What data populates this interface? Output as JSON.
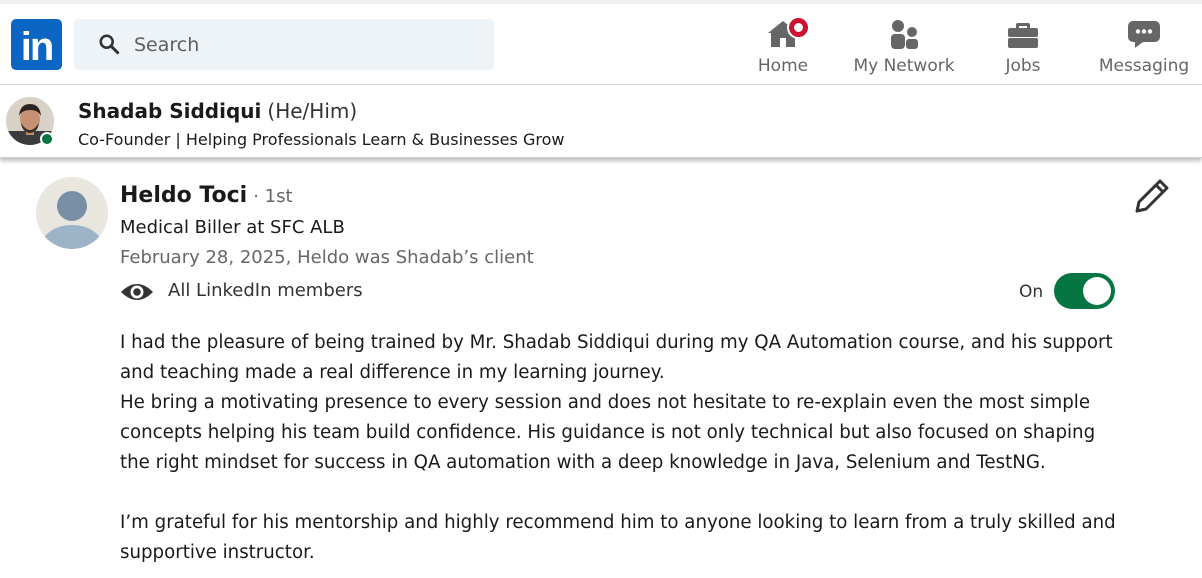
{
  "nav": {
    "logo_text": "in",
    "search_placeholder": "Search",
    "items": [
      {
        "label": "Home",
        "icon": "home-icon",
        "has_notification": true
      },
      {
        "label": "My Network",
        "icon": "people-icon"
      },
      {
        "label": "Jobs",
        "icon": "briefcase-icon"
      },
      {
        "label": "Messaging",
        "icon": "chat-icon"
      }
    ]
  },
  "profile": {
    "name": "Shadab Siddiqui",
    "pronouns": "(He/Him)",
    "headline": "Co-Founder | Helping Professionals Learn & Businesses Grow",
    "online": true
  },
  "recommendation": {
    "author_name": "Heldo Toci",
    "connection_degree": "· 1st",
    "author_title": "Medical Biller at SFC ALB",
    "meta": "February 28, 2025, Heldo was Shadab’s client",
    "visibility": "All LinkedIn members",
    "toggle_label": "On",
    "toggle_on": true,
    "paragraphs": [
      "I had the pleasure of being trained by Mr. Shadab Siddiqui during my QA Automation course, and his support and teaching made a real difference in my learning journey.",
      "He bring a motivating presence to every session and does not hesitate to re-explain even the most simple concepts helping his team build confidence. His guidance is not only technical but also focused on shaping the right mindset for success in QA automation with a deep knowledge in Java, Selenium and TestNG.",
      "I’m grateful for his mentorship and highly recommend him to anyone looking to learn from a truly skilled and supportive instructor."
    ]
  },
  "colors": {
    "brand": "#0a66c2",
    "toggle_on": "#057642",
    "notification": "#cb112d",
    "online": "#057642"
  }
}
